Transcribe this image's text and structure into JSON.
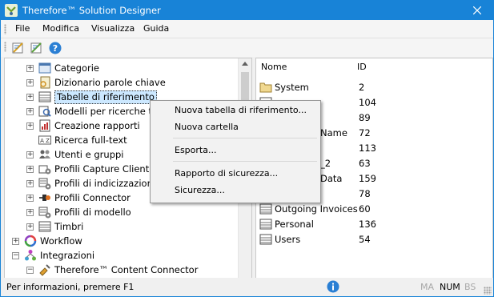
{
  "window": {
    "title": "Therefore™ Solution Designer",
    "accent": "#1883d7"
  },
  "menu": [
    "File",
    "Modifica",
    "Visualizza",
    "Guida"
  ],
  "toolbar": {
    "icons": [
      "designer-icon",
      "edit-designer-icon",
      "help-icon"
    ]
  },
  "tree": [
    {
      "label": "Categorie",
      "icon": "category-icon"
    },
    {
      "label": "Dizionario parole chiave",
      "icon": "dictionary-icon"
    },
    {
      "label": "Tabelle di riferimento",
      "icon": "table-icon",
      "selected": true
    },
    {
      "label": "Modelli per ricerche tra",
      "icon": "search-template-icon"
    },
    {
      "label": "Creazione rapporti",
      "icon": "report-icon"
    },
    {
      "label": "Ricerca full-text",
      "icon": "fulltext-icon"
    },
    {
      "label": "Utenti e gruppi",
      "icon": "users-icon"
    },
    {
      "label": "Profili Capture Client",
      "icon": "capture-icon"
    },
    {
      "label": "Profili di indicizzazione",
      "icon": "indexing-icon"
    },
    {
      "label": "Profili Connector",
      "icon": "connector-icon"
    },
    {
      "label": "Profili di modello",
      "icon": "model-icon"
    },
    {
      "label": "Timbri",
      "icon": "stamp-icon"
    },
    {
      "label": "Workflow",
      "icon": "workflow-icon"
    },
    {
      "label": "Integrazioni",
      "icon": "integrations-icon"
    },
    {
      "label": "Therefore™ Content Connector",
      "icon": "content-connector-icon"
    }
  ],
  "list": {
    "columns": [
      "Nome",
      "ID"
    ],
    "rows": [
      {
        "name": "System",
        "id": "2",
        "icon": "folder-icon"
      },
      {
        "name": "",
        "id": "104",
        "icon": "table-icon"
      },
      {
        "name": "",
        "id": "89",
        "icon": "table-icon"
      },
      {
        "name": "Name",
        "id": "72",
        "icon": "table-icon"
      },
      {
        "name": "",
        "id": "113",
        "icon": "table-icon"
      },
      {
        "name": "_2",
        "id": "63",
        "icon": "table-icon"
      },
      {
        "name": "Data",
        "id": "159",
        "icon": "table-icon"
      },
      {
        "name": "",
        "id": "78",
        "icon": "table-icon"
      },
      {
        "name": "Outgoing Invoices",
        "id": "60",
        "icon": "table-icon"
      },
      {
        "name": "Personal",
        "id": "136",
        "icon": "table-icon"
      },
      {
        "name": "Users",
        "id": "54",
        "icon": "table-icon"
      }
    ]
  },
  "context_menu": {
    "items": [
      "Nuova tabella di riferimento...",
      "Nuova cartella",
      "Esporta...",
      "Rapporto di sicurezza...",
      "Sicurezza..."
    ]
  },
  "status": {
    "text": "Per informazioni, premere F1",
    "indicators": [
      {
        "label": "MA",
        "active": false
      },
      {
        "label": "NUM",
        "active": true
      },
      {
        "label": "BS",
        "active": false
      }
    ]
  }
}
